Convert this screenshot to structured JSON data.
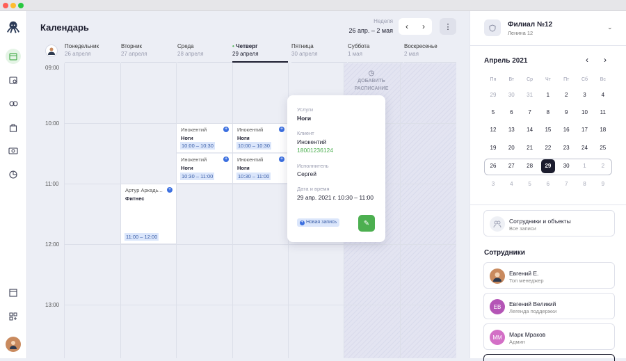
{
  "calendar": {
    "title": "Календарь",
    "week_label": "Неделя",
    "week_range": "26 апр. – 2 мая",
    "prev": "‹",
    "next": "›",
    "more": "⋮",
    "days": [
      {
        "name": "Понедельник",
        "date": "26 апреля"
      },
      {
        "name": "Вторник",
        "date": "27 апреля"
      },
      {
        "name": "Среда",
        "date": "28 апреля"
      },
      {
        "name": "Четверг",
        "date": "29 апреля"
      },
      {
        "name": "Пятница",
        "date": "30 апреля"
      },
      {
        "name": "Суббота",
        "date": "1 мая"
      },
      {
        "name": "Воскресенье",
        "date": "2 мая"
      }
    ],
    "times": [
      "09:00",
      "10:00",
      "11:00",
      "12:00",
      "13:00"
    ],
    "add_schedule": "ДОБАВИТЬ РАСПИСАНИЕ",
    "events": [
      {
        "name": "Инокентий",
        "service": "Ноги",
        "time": "10:00 – 10:30"
      },
      {
        "name": "Инокентий",
        "service": "Ноги",
        "time": "10:00 – 10:30"
      },
      {
        "name": "Инокентий",
        "service": "Ноги",
        "time": "10:30 – 11:00"
      },
      {
        "name": "Инокентий",
        "service": "Ноги",
        "time": "10:30 – 11:00"
      },
      {
        "name": "Артур Аркадь...",
        "service": "Фитнес",
        "time": "11:00 – 12:00"
      }
    ]
  },
  "popup": {
    "services_label": "Услуги",
    "services": "Ноги",
    "client_label": "Клиент",
    "client": "Инокентий",
    "phone": "18001236124",
    "executor_label": "Исполнитель",
    "executor": "Сергей",
    "datetime_label": "Дата и время",
    "datetime": "29 апр. 2021 г. 10:30 – 11:00",
    "badge": "Новая запись",
    "edit_icon": "✎"
  },
  "sidebar": {
    "branch_name": "Филиал №12",
    "branch_address": "Ленина 12",
    "month": "Апрель 2021",
    "weekdays": [
      "Пн",
      "Вт",
      "Ср",
      "Чт",
      "Пт",
      "Сб",
      "Вс"
    ],
    "weeks": [
      [
        "29",
        "30",
        "31",
        "1",
        "2",
        "3",
        "4"
      ],
      [
        "5",
        "6",
        "7",
        "8",
        "9",
        "10",
        "11"
      ],
      [
        "12",
        "13",
        "14",
        "15",
        "16",
        "17",
        "18"
      ],
      [
        "19",
        "20",
        "21",
        "22",
        "23",
        "24",
        "25"
      ],
      [
        "26",
        "27",
        "28",
        "29",
        "30",
        "1",
        "2"
      ],
      [
        "3",
        "4",
        "5",
        "6",
        "7",
        "8",
        "9"
      ]
    ],
    "staff_objects_title": "Сотрудники и объекты",
    "staff_objects_sub": "Все записи",
    "employees_title": "Сотрудники",
    "employees": [
      {
        "initials": "",
        "name": "Евгений Е.",
        "role": "Топ менеджер",
        "color": "#c98a5e"
      },
      {
        "initials": "ЕВ",
        "name": "Евгений Великий",
        "role": "Легенда поддержки",
        "color": "#b455b6"
      },
      {
        "initials": "ММ",
        "name": "Марк Мраков",
        "role": "Админ",
        "color": "#d36fc6"
      }
    ]
  },
  "colors": {
    "accent": "#4caf50",
    "dark": "#1c1d2e",
    "event_blue": "#3b6fe0"
  }
}
